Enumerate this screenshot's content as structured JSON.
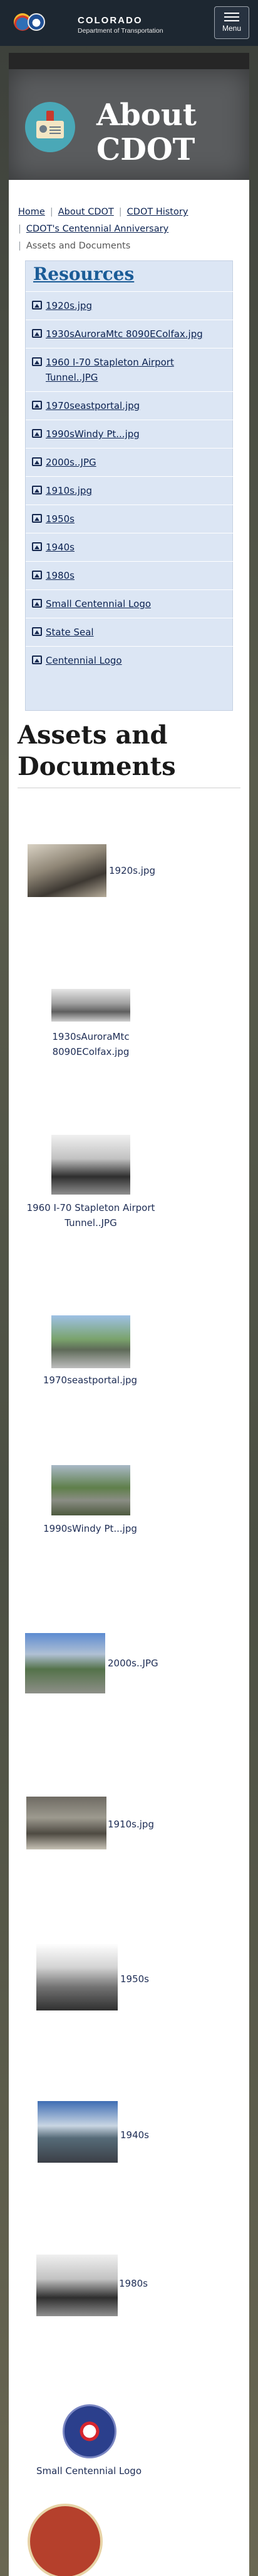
{
  "header": {
    "brand_name": "COLORADO",
    "brand_sub": "Department of Transportation",
    "menu_label": "Menu"
  },
  "hero": {
    "title": "About CDOT"
  },
  "breadcrumb": {
    "items": [
      "Home",
      "About CDOT",
      "CDOT History",
      "CDOT's Centennial Anniversary"
    ],
    "current": "Assets and Documents"
  },
  "resources": {
    "title": "Resources",
    "items": [
      "1920s.jpg",
      "1930sAuroraMtc 8090EColfax.jpg",
      "1960 I-70 Stapleton Airport Tunnel..JPG",
      "1970seastportal.jpg",
      "1990sWindy Pt...jpg",
      "2000s..JPG",
      "1910s.jpg",
      "1950s",
      "1940s",
      "1980s",
      "Small Centennial Logo",
      "State Seal",
      "Centennial Logo"
    ]
  },
  "section": {
    "title": "Assets and Documents"
  },
  "assets": [
    "1920s.jpg",
    "1930sAuroraMtc 8090EColfax.jpg",
    "1960 I-70 Stapleton Airport Tunnel..JPG",
    "1970seastportal.jpg",
    "1990sWindy Pt...jpg",
    "2000s..JPG",
    "1910s.jpg",
    "1950s",
    "1940s",
    "1980s",
    "Small Centennial Logo"
  ]
}
